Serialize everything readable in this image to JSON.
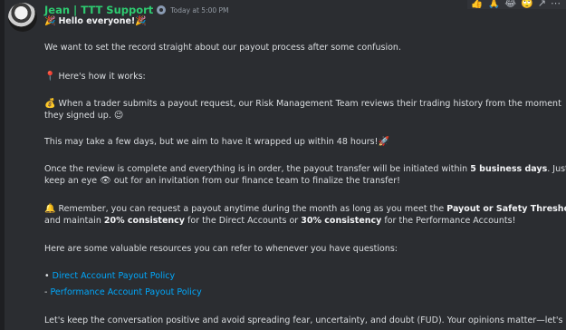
{
  "message": {
    "author": "Jean | TTT Support",
    "timestamp": "Today at 5:00 PM",
    "reactions": [
      "👍",
      "🙏",
      "😂",
      "🙄",
      "↗",
      "⋯"
    ],
    "greeting_emoji_left": "🎉",
    "greeting": "Hello everyone!",
    "greeting_emoji_right": "🎉",
    "intro": "We want to set the record straight about our payout process after some confusion.",
    "how_emoji": "📍",
    "how": "Here's how it works:",
    "p1_emoji": "💰",
    "p1_a": "When a trader submits a payout request, our Risk Management Team reviews their trading history from the moment",
    "p1_b": "they signed up.",
    "p1_end_emoji": "😉",
    "p2": "This may take a few days, but we aim to have it wrapped up within 48 hours!",
    "p2_emoji": "🚀",
    "p3_a": "Once the review is complete and everything is in order, the payout transfer will be initiated within",
    "p3_bold": "5 business days",
    "p3_b": ". Just",
    "p3_c_1": "keep an eye",
    "p3_eye": "👁",
    "p3_c_2": "out for an invitation from our finance team to finalize the transfer!",
    "p4_emoji": "🔔",
    "p4_a": "Remember, you can request a payout anytime during the month as long as you meet the",
    "p4_bold1": "Payout or Safety Threshold",
    "p4_b": "and maintain",
    "p4_bold2": "20% consistency",
    "p4_c": "for the Direct Accounts or",
    "p4_bold3": "30% consistency",
    "p4_d": "for the Performance Accounts!",
    "p5": "Here are some valuable resources you can refer to whenever you have questions:",
    "bullet1": "•",
    "link1": "Direct Account Payout Policy",
    "bullet2": "-",
    "link2": "Performance Account Payout Policy",
    "p6": "Let's keep the conversation positive and avoid spreading fear, uncertainty, and doubt (FUD). Your opinions matter—let's"
  }
}
